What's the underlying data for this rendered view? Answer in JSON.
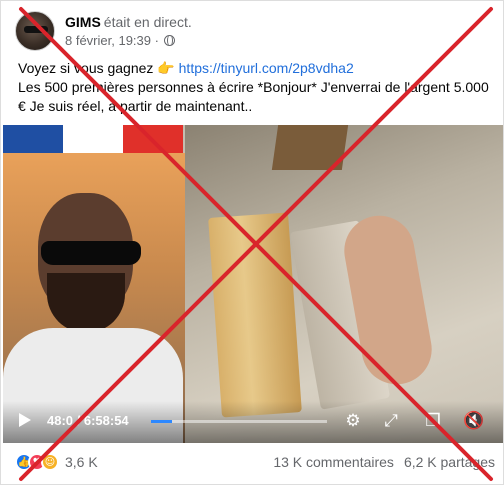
{
  "header": {
    "author": "GIMS",
    "status": "était en direct.",
    "date": "8 février, 19:39 ·"
  },
  "post": {
    "line1_prefix": "Voyez si vous gagnez",
    "pointer_emoji": "👉",
    "link": "https://tinyurl.com/2p8vdha2",
    "line2": "Les 500 premières personnes à écrire *Bonjour* J'enverrai de l'argent 5.000 € Je suis réel, à partir de maintenant.."
  },
  "video": {
    "time": "48:0 / 6:58:54",
    "progress_fraction": 0.12,
    "flag_colors": [
      "#1f4fa3",
      "#ffffff",
      "#e0302a"
    ]
  },
  "footer": {
    "reaction_count": "3,6 K",
    "comments": "13 K commentaires",
    "shares": "6,2 K partages"
  },
  "icons": {
    "play": "play-icon",
    "settings": "gear-icon",
    "expand": "expand-icon",
    "miniplayer": "miniplayer-icon",
    "volume": "volume-muted-icon",
    "like": "like-reaction-icon",
    "love": "love-reaction-icon",
    "wow": "wow-reaction-icon"
  },
  "overlay_color": "#d9242b"
}
